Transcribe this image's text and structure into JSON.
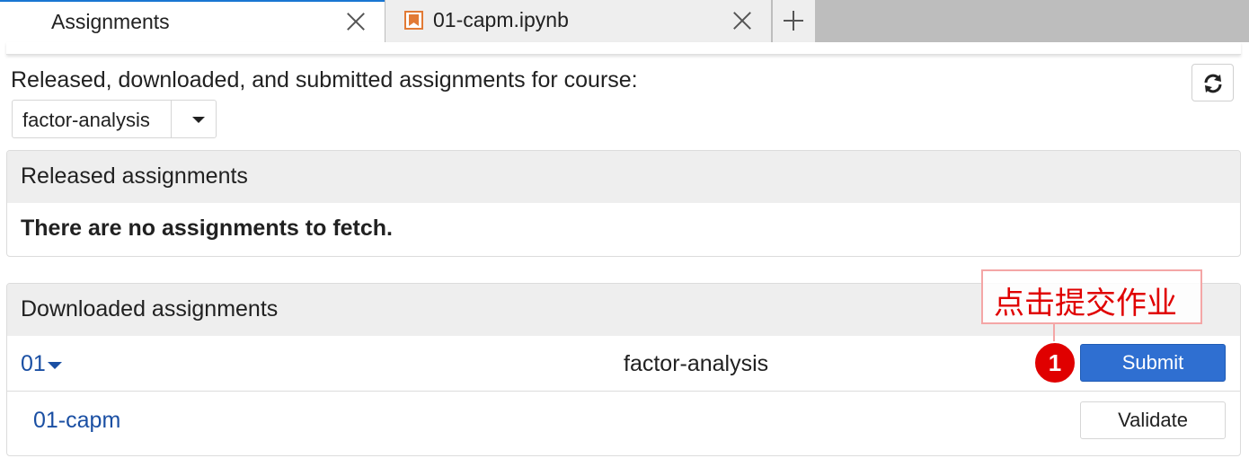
{
  "tabs": [
    {
      "label": "Assignments",
      "active": true
    },
    {
      "label": "01-capm.ipynb",
      "active": false
    }
  ],
  "header": {
    "course_prompt": "Released, downloaded, and submitted assignments for course:",
    "selected_course": "factor-analysis"
  },
  "released": {
    "title": "Released assignments",
    "empty_message": "There are no assignments to fetch."
  },
  "downloaded": {
    "title": "Downloaded assignments",
    "assignment": {
      "name": "01",
      "course": "factor-analysis",
      "submit_label": "Submit",
      "notebook": "01-capm",
      "validate_label": "Validate"
    }
  },
  "annotation": {
    "callout_text": "点击提交作业",
    "badge": "1",
    "color": "#e00000"
  },
  "colors": {
    "accent": "#1976d2",
    "link": "#1a4fa3",
    "submit_button": "#2f6fd1",
    "notebook_icon": "#e27a35"
  }
}
